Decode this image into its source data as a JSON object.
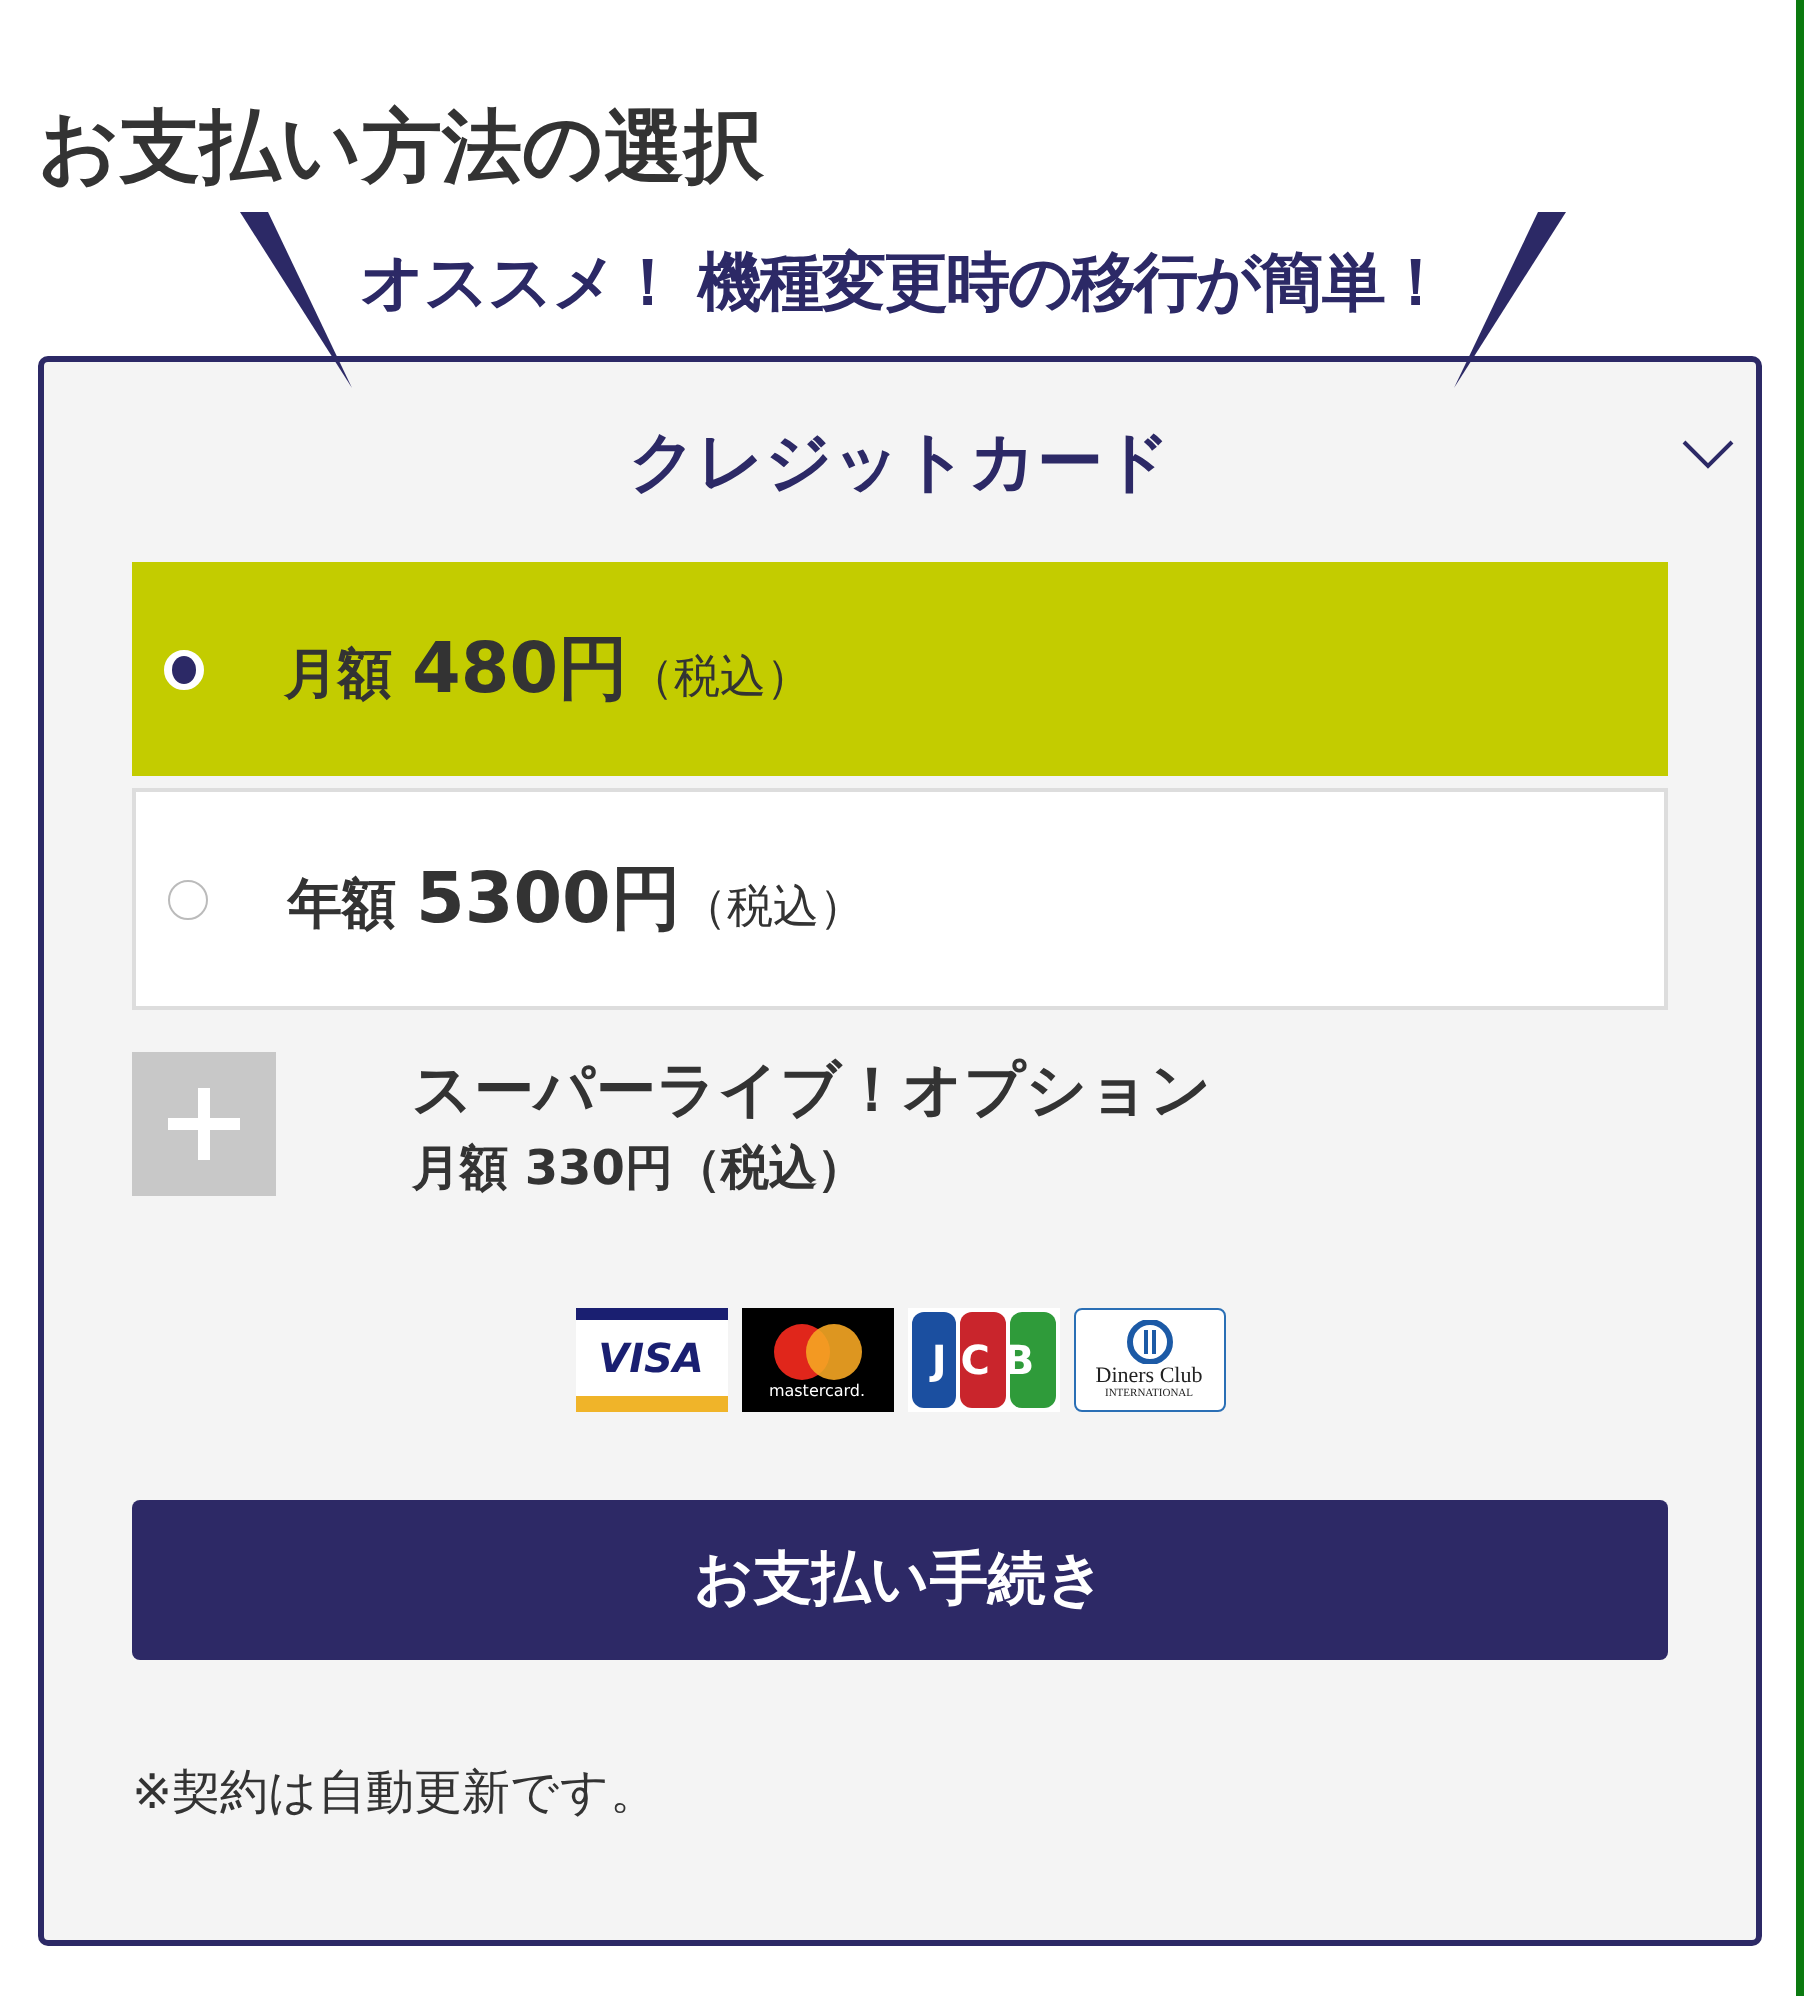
{
  "title": "お支払い方法の選択",
  "banner": "オススメ！ 機種変更時の移行が簡単！",
  "panel": {
    "heading": "クレジットカード",
    "expanded": true,
    "plans": [
      {
        "period": "月額",
        "amount": "480円",
        "tax": "（税込）",
        "selected": true
      },
      {
        "period": "年額",
        "amount": "5300円",
        "tax": "（税込）",
        "selected": false
      }
    ],
    "option": {
      "name": "スーパーライブ！オプション",
      "price": "月額 330円（税込）",
      "added": false
    },
    "cards": [
      {
        "kind": "visa",
        "lines": [
          "VISA"
        ]
      },
      {
        "kind": "mastercard",
        "lines": [
          "mastercard."
        ]
      },
      {
        "kind": "jcb",
        "lines": [
          "JCB"
        ]
      },
      {
        "kind": "diners",
        "lines": [
          "Diners Club",
          "INTERNATIONAL"
        ]
      }
    ],
    "submit": "お支払い手続き",
    "note": "※契約は自動更新です。"
  }
}
